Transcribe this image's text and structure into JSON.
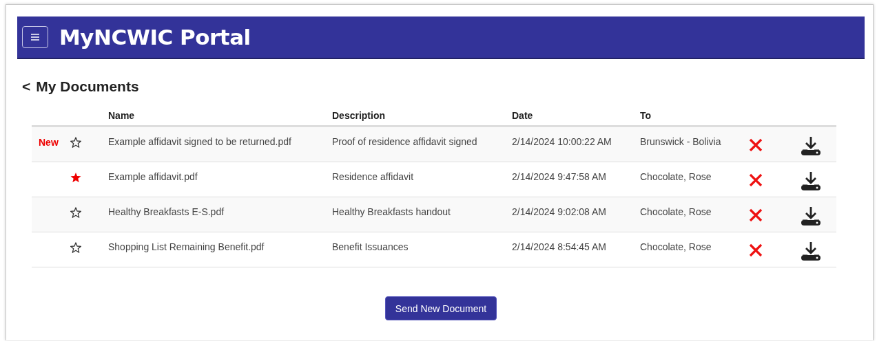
{
  "header": {
    "title": "MyNCWIC Portal"
  },
  "page": {
    "back": "<",
    "title": "My Documents"
  },
  "table": {
    "columns": [
      "Name",
      "Description",
      "Date",
      "To"
    ],
    "rows": [
      {
        "badge": "New",
        "starred": false,
        "name": "Example affidavit signed to be returned.pdf",
        "description": "Proof of residence affidavit signed",
        "date": "2/14/2024 10:00:22 AM",
        "to": "Brunswick - Bolivia"
      },
      {
        "starred": true,
        "name": "Example affidavit.pdf",
        "description": "Residence affidavit",
        "date": "2/14/2024 9:47:58 AM",
        "to": "Chocolate, Rose"
      },
      {
        "starred": false,
        "name": "Healthy Breakfasts E-S.pdf",
        "description": "Healthy Breakfasts handout",
        "date": "2/14/2024 9:02:08 AM",
        "to": "Chocolate, Rose"
      },
      {
        "starred": false,
        "name": "Shopping List Remaining Benefit.pdf",
        "description": "Benefit Issuances",
        "date": "2/14/2024 8:54:45 AM",
        "to": "Chocolate, Rose"
      }
    ]
  },
  "send_button": "Send New Document"
}
